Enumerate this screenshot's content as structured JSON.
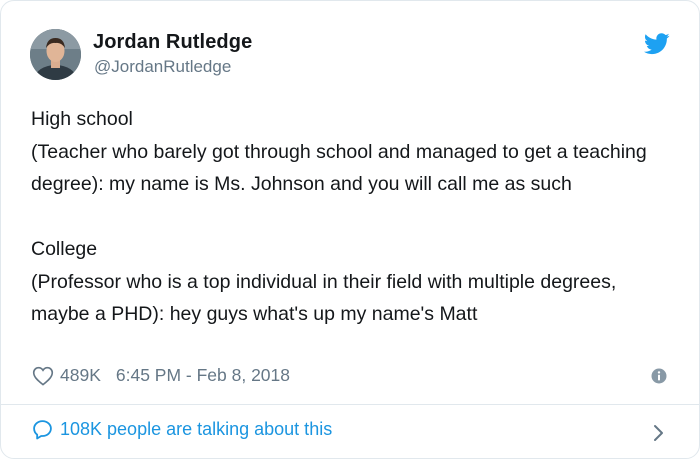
{
  "colors": {
    "text": "#14171a",
    "secondary": "#657786",
    "link": "#1b95e0",
    "twitter_blue": "#1da1f2",
    "border": "#e1e8ed"
  },
  "author": {
    "name": "Jordan Rutledge",
    "handle": "@JordanRutledge",
    "avatar_icon": "user-avatar-photo"
  },
  "brand_icon": "twitter-bird-icon",
  "tweet": {
    "lines": [
      "High school",
      "(Teacher who barely got through school and managed to get a teaching degree): my name is Ms. Johnson and you will call me as such",
      "College",
      "(Professor who is a top individual in their field with multiple degrees, maybe a PHD): hey guys what's up my name's Matt"
    ]
  },
  "meta": {
    "likes": "489K",
    "timestamp": "6:45 PM - Feb 8, 2018",
    "heart_icon": "heart-outline-icon",
    "info_icon": "info-icon"
  },
  "footer": {
    "talking_text": "108K people are talking about this",
    "bubble_icon": "speech-bubble-icon",
    "chevron_icon": "chevron-right-icon"
  }
}
